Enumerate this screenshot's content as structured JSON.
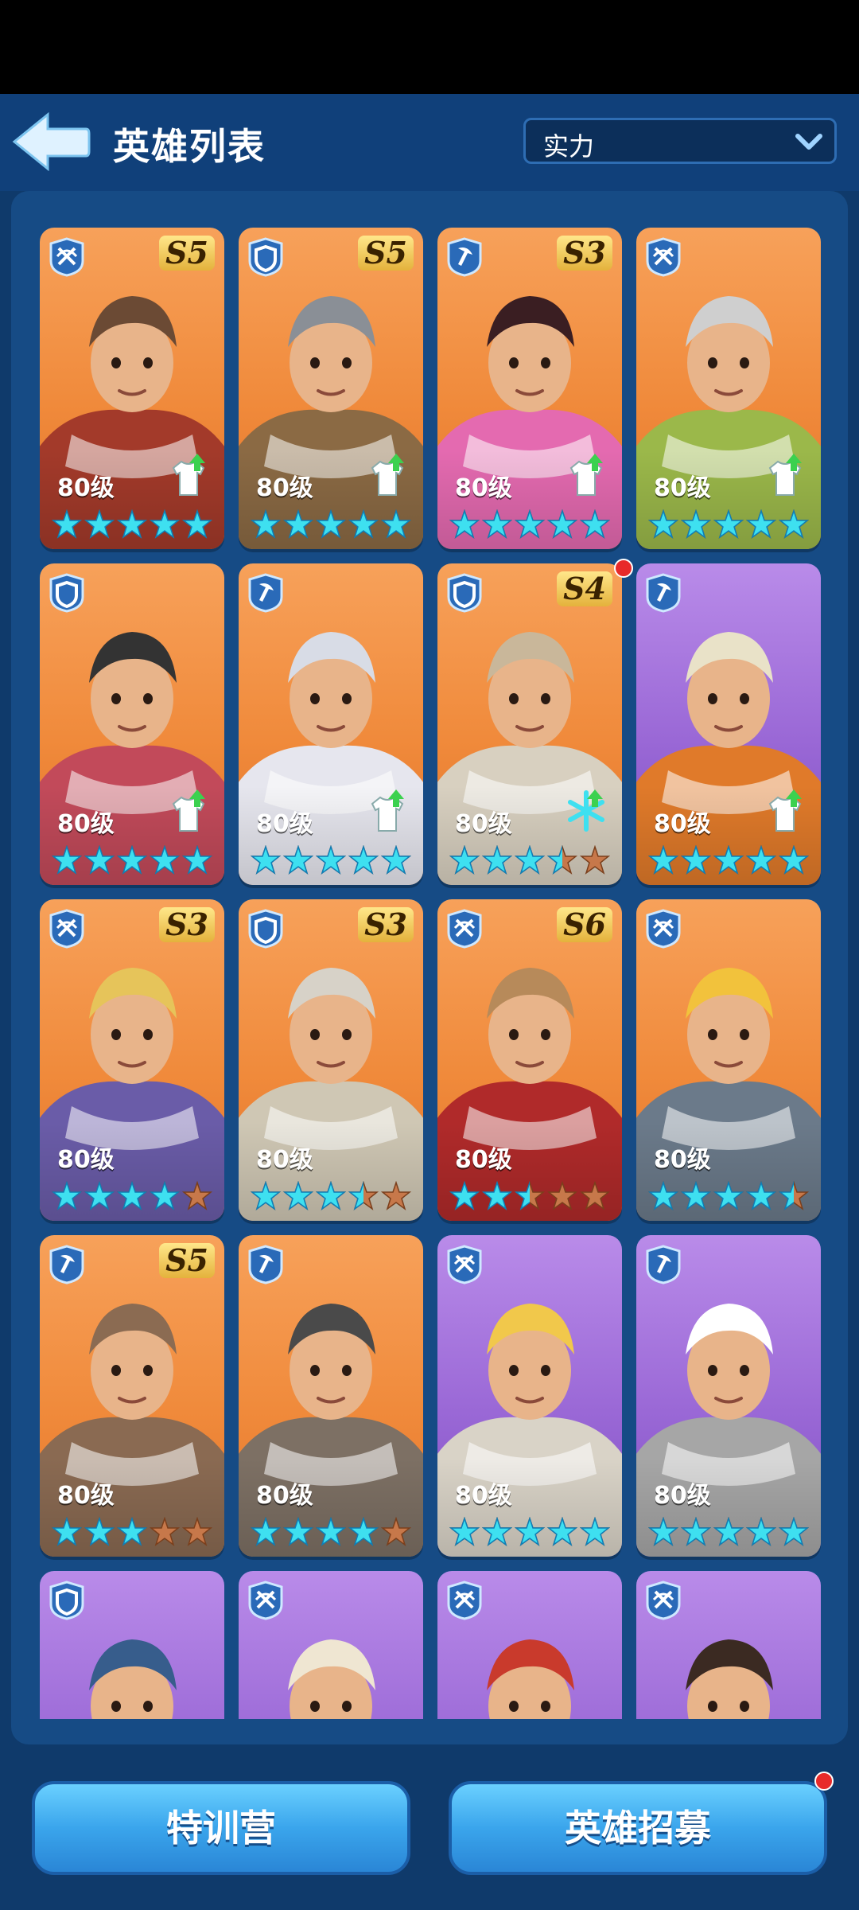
{
  "header": {
    "title": "英雄列表",
    "sort_value": "实力"
  },
  "colors": {
    "orange_card": "#f08a3b",
    "purple_card": "#9a68d6",
    "star_on": "#3ee0f0",
    "star_off": "#c7784a",
    "upgrade_arrow": "#3bd14f"
  },
  "heroes": [
    {
      "role": "crossbow-icon",
      "season": "S5",
      "level": "80级",
      "stars": 5,
      "upgrade": true,
      "frame": "orange",
      "look": "aviator"
    },
    {
      "role": "shield-icon",
      "season": "S5",
      "level": "80级",
      "stars": 5,
      "upgrade": true,
      "frame": "orange",
      "look": "gladiator"
    },
    {
      "role": "pickaxe-icon",
      "season": "S3",
      "level": "80级",
      "stars": 5,
      "upgrade": true,
      "frame": "orange",
      "look": "earmuff"
    },
    {
      "role": "crossbow-icon",
      "season": "",
      "level": "80级",
      "stars": 5,
      "upgrade": true,
      "frame": "orange",
      "look": "elder"
    },
    {
      "role": "shield-icon",
      "season": "",
      "level": "80级",
      "stars": 5,
      "upgrade": true,
      "frame": "orange",
      "look": "welder"
    },
    {
      "role": "pickaxe-icon",
      "season": "",
      "level": "80级",
      "stars": 5,
      "upgrade": true,
      "frame": "orange",
      "look": "silverhair"
    },
    {
      "role": "shield-icon",
      "season": "S4",
      "level": "80级",
      "stars": 3.5,
      "upgrade": true,
      "frame": "orange",
      "look": "hooded",
      "notify": true,
      "special": "snowflake"
    },
    {
      "role": "pickaxe-icon",
      "season": "",
      "level": "80级",
      "stars": 5,
      "upgrade": true,
      "frame": "purple",
      "look": "viking"
    },
    {
      "role": "crossbow-icon",
      "season": "S3",
      "level": "80级",
      "stars": 4,
      "upgrade": false,
      "frame": "orange",
      "look": "blond"
    },
    {
      "role": "shield-icon",
      "season": "S3",
      "level": "80级",
      "stars": 3.5,
      "upgrade": false,
      "frame": "orange",
      "look": "grizzled"
    },
    {
      "role": "crossbow-icon",
      "season": "S6",
      "level": "80级",
      "stars": 2.5,
      "upgrade": false,
      "frame": "orange",
      "look": "cowboy"
    },
    {
      "role": "crossbow-icon",
      "season": "",
      "level": "80级",
      "stars": 4.5,
      "upgrade": false,
      "frame": "orange",
      "look": "miner"
    },
    {
      "role": "pickaxe-icon",
      "season": "S5",
      "level": "80级",
      "stars": 3,
      "upgrade": false,
      "frame": "orange",
      "look": "pilot"
    },
    {
      "role": "pickaxe-icon",
      "season": "",
      "level": "80级",
      "stars": 4,
      "upgrade": false,
      "frame": "orange",
      "look": "plague"
    },
    {
      "role": "crossbow-icon",
      "season": "",
      "level": "80级",
      "stars": 5,
      "upgrade": false,
      "frame": "purple",
      "look": "goggles"
    },
    {
      "role": "pickaxe-icon",
      "season": "",
      "level": "80级",
      "stars": 5,
      "upgrade": false,
      "frame": "purple",
      "look": "chef"
    },
    {
      "role": "shield-icon",
      "season": "",
      "level": "",
      "stars": 0,
      "upgrade": false,
      "frame": "purple",
      "look": "helmet"
    },
    {
      "role": "crossbow-icon",
      "season": "",
      "level": "",
      "stars": 0,
      "upgrade": false,
      "frame": "purple",
      "look": "bedouin"
    },
    {
      "role": "crossbow-icon",
      "season": "",
      "level": "",
      "stars": 0,
      "upgrade": false,
      "frame": "purple",
      "look": "redhead"
    },
    {
      "role": "crossbow-icon",
      "season": "",
      "level": "",
      "stars": 0,
      "upgrade": false,
      "frame": "purple",
      "look": "girl"
    }
  ],
  "buttons": {
    "training_label": "特训营",
    "recruit_label": "英雄招募"
  }
}
